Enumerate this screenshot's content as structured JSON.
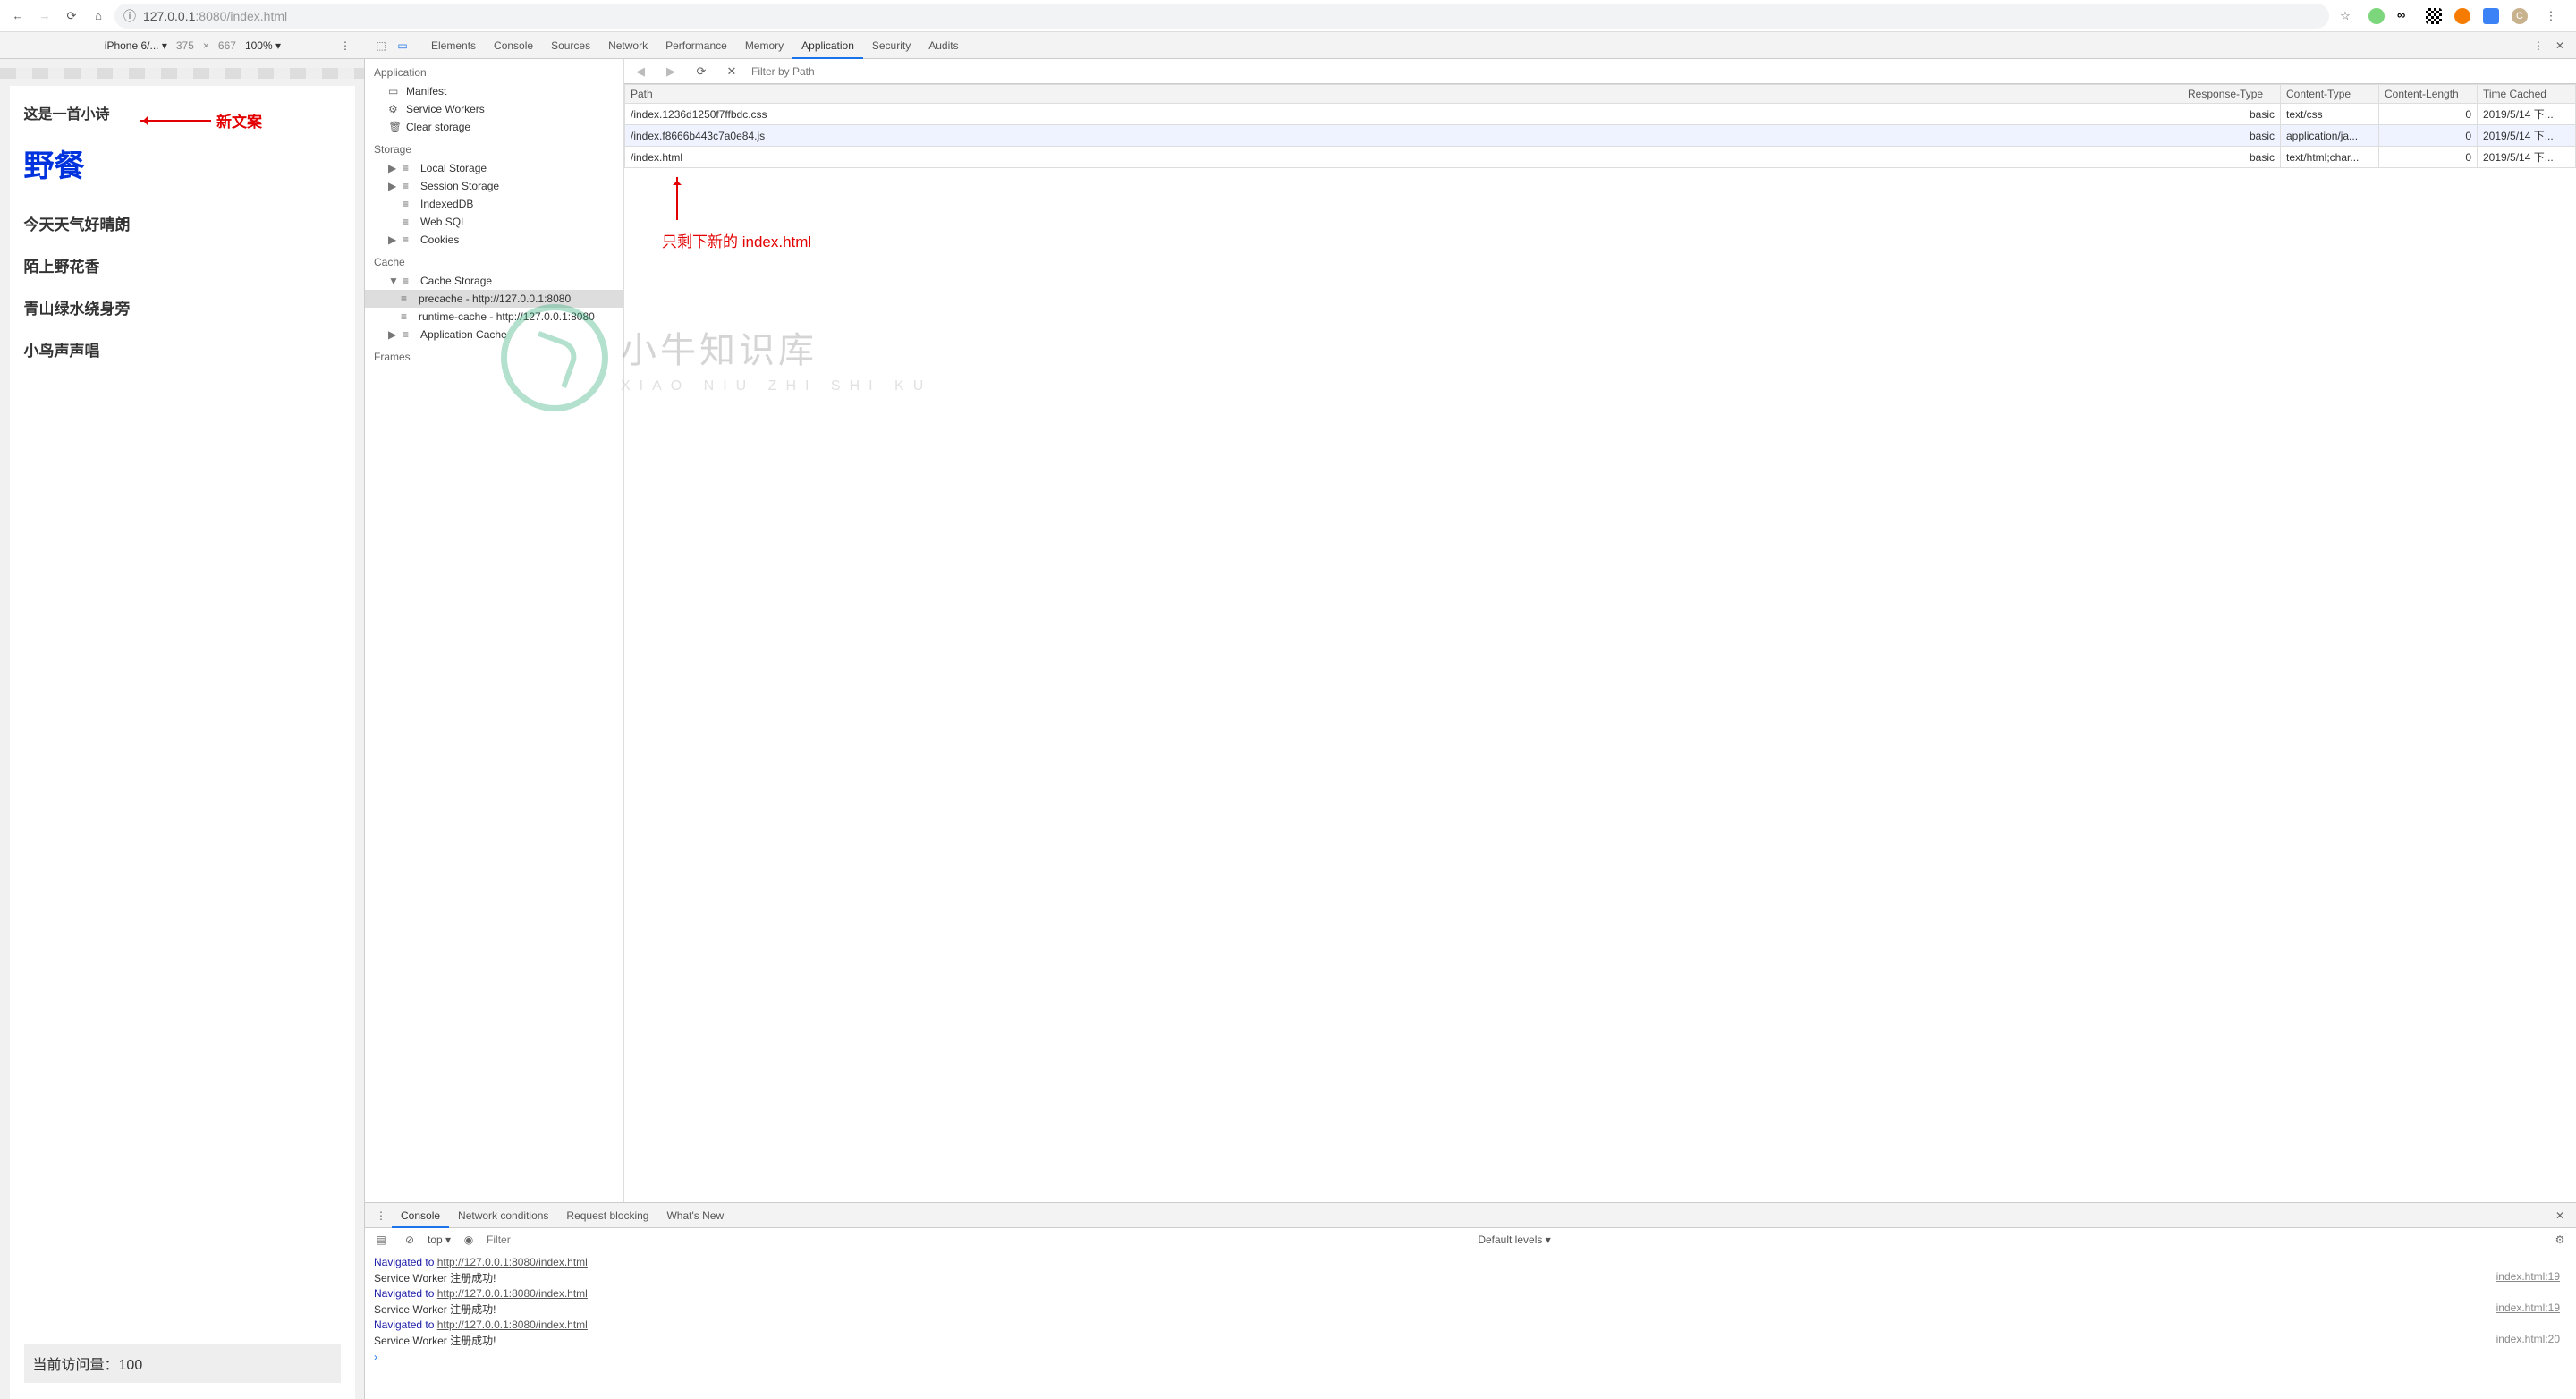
{
  "browser": {
    "url": "127.0.0.1:8080/index.html",
    "url_prefix": "127.0.0.1",
    "url_port": ":8080",
    "url_path": "/index.html"
  },
  "device_toolbar": {
    "device": "iPhone 6/... ▾",
    "width": "375",
    "sep": "×",
    "height": "667",
    "zoom": "100% ▾"
  },
  "devtools_tabs": [
    "Elements",
    "Console",
    "Sources",
    "Network",
    "Performance",
    "Memory",
    "Application",
    "Security",
    "Audits"
  ],
  "devtools_active": "Application",
  "sidebar": {
    "application": {
      "title": "Application",
      "items": [
        "Manifest",
        "Service Workers",
        "Clear storage"
      ]
    },
    "storage": {
      "title": "Storage",
      "items": [
        "Local Storage",
        "Session Storage",
        "IndexedDB",
        "Web SQL",
        "Cookies"
      ]
    },
    "cache": {
      "title": "Cache",
      "cache_storage": "Cache Storage",
      "caches": [
        "precache - http://127.0.0.1:8080",
        "runtime-cache - http://127.0.0.1:8080"
      ],
      "app_cache": "Application Cache"
    },
    "frames": {
      "title": "Frames"
    }
  },
  "cache_panel": {
    "filter_placeholder": "Filter by Path",
    "columns": [
      "Path",
      "Response-Type",
      "Content-Type",
      "Content-Length",
      "Time Cached"
    ],
    "rows": [
      {
        "path": "/index.1236d1250f7ffbdc.css",
        "rtype": "basic",
        "ctype": "text/css",
        "len": "0",
        "time": "2019/5/14 下..."
      },
      {
        "path": "/index.f8666b443c7a0e84.js",
        "rtype": "basic",
        "ctype": "application/ja...",
        "len": "0",
        "time": "2019/5/14 下..."
      },
      {
        "path": "/index.html",
        "rtype": "basic",
        "ctype": "text/html;char...",
        "len": "0",
        "time": "2019/5/14 下..."
      }
    ]
  },
  "drawer_tabs": [
    "Console",
    "Network conditions",
    "Request blocking",
    "What's New"
  ],
  "drawer_active": "Console",
  "console_toolbar": {
    "context": "top ▾",
    "filter_placeholder": "Filter",
    "levels": "Default levels ▾"
  },
  "console": [
    {
      "type": "nav",
      "prefix": "Navigated to ",
      "url": "http://127.0.0.1:8080/index.html"
    },
    {
      "type": "log",
      "msg": "Service Worker 注册成功!",
      "src": "index.html:19"
    },
    {
      "type": "nav",
      "prefix": "Navigated to ",
      "url": "http://127.0.0.1:8080/index.html"
    },
    {
      "type": "log",
      "msg": "Service Worker 注册成功!",
      "src": "index.html:19"
    },
    {
      "type": "nav",
      "prefix": "Navigated to ",
      "url": "http://127.0.0.1:8080/index.html"
    },
    {
      "type": "log",
      "msg": "Service Worker 注册成功!",
      "src": "index.html:20"
    }
  ],
  "page": {
    "tagline": "这是一首小诗",
    "title": "野餐",
    "lines": [
      "今天天气好晴朗",
      "陌上野花香",
      "青山绿水绕身旁",
      "小鸟声声唱"
    ],
    "footer_label": "当前访问量：",
    "footer_count": "100"
  },
  "annotations": {
    "new_copy": "新文案",
    "only_index": "只剩下新的 index.html"
  },
  "watermark": {
    "main": "小牛知识库",
    "sub": "XIAO NIU ZHI SHI KU"
  }
}
